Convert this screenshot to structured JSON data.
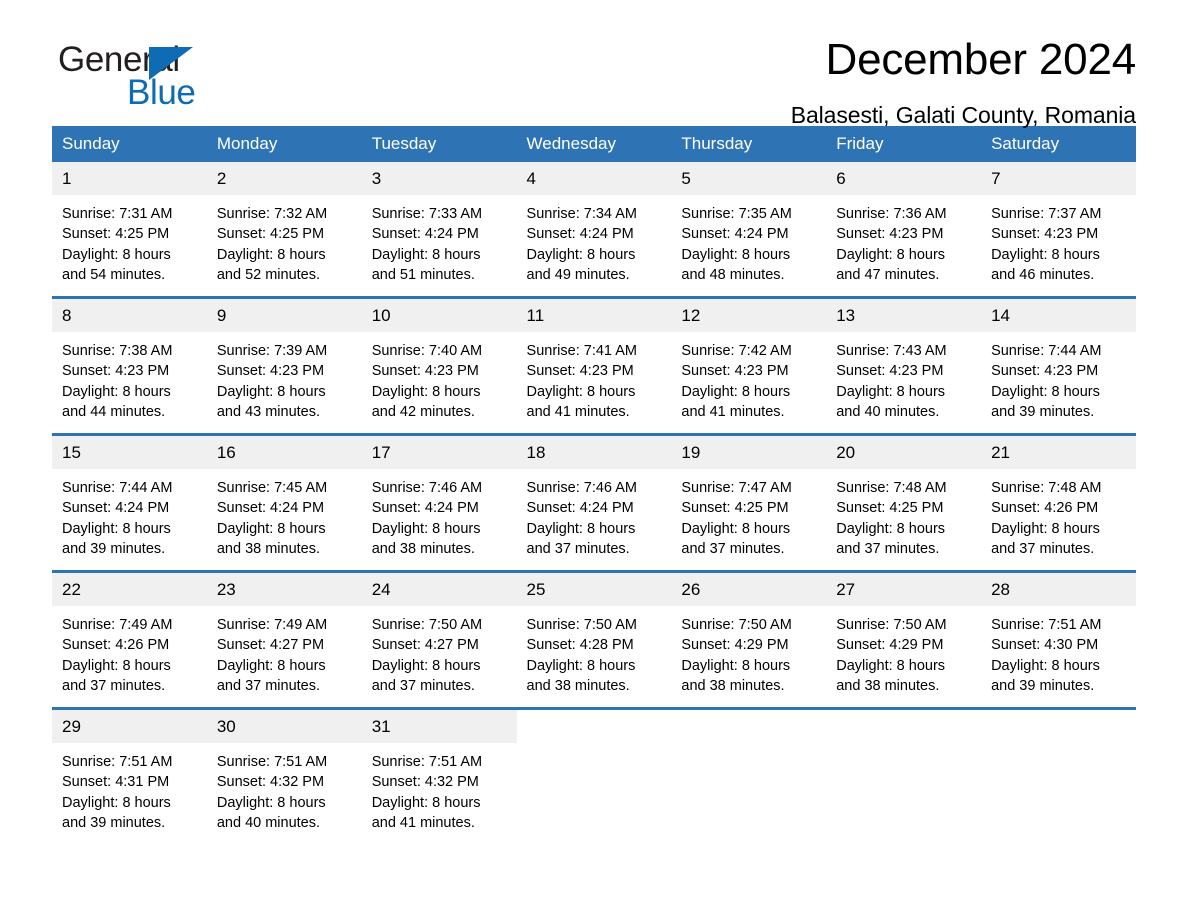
{
  "brand": {
    "name_top": "General",
    "name_bottom": "Blue",
    "triangle_icon": "triangle-icon",
    "color_blue": "#0e6cb5",
    "color_black": "#231f20"
  },
  "header": {
    "title": "December 2024",
    "subtitle": "Balasesti, Galati County, Romania"
  },
  "theme": {
    "header_blue": "#2e74b5",
    "daynum_band": "#f0f0f0",
    "text": "#000000"
  },
  "calendar": {
    "weekday_headers": [
      "Sunday",
      "Monday",
      "Tuesday",
      "Wednesday",
      "Thursday",
      "Friday",
      "Saturday"
    ],
    "weeks": [
      [
        {
          "day": "1",
          "info": "Sunrise: 7:31 AM\nSunset: 4:25 PM\nDaylight: 8 hours\nand 54 minutes."
        },
        {
          "day": "2",
          "info": "Sunrise: 7:32 AM\nSunset: 4:25 PM\nDaylight: 8 hours\nand 52 minutes."
        },
        {
          "day": "3",
          "info": "Sunrise: 7:33 AM\nSunset: 4:24 PM\nDaylight: 8 hours\nand 51 minutes."
        },
        {
          "day": "4",
          "info": "Sunrise: 7:34 AM\nSunset: 4:24 PM\nDaylight: 8 hours\nand 49 minutes."
        },
        {
          "day": "5",
          "info": "Sunrise: 7:35 AM\nSunset: 4:24 PM\nDaylight: 8 hours\nand 48 minutes."
        },
        {
          "day": "6",
          "info": "Sunrise: 7:36 AM\nSunset: 4:23 PM\nDaylight: 8 hours\nand 47 minutes."
        },
        {
          "day": "7",
          "info": "Sunrise: 7:37 AM\nSunset: 4:23 PM\nDaylight: 8 hours\nand 46 minutes."
        }
      ],
      [
        {
          "day": "8",
          "info": "Sunrise: 7:38 AM\nSunset: 4:23 PM\nDaylight: 8 hours\nand 44 minutes."
        },
        {
          "day": "9",
          "info": "Sunrise: 7:39 AM\nSunset: 4:23 PM\nDaylight: 8 hours\nand 43 minutes."
        },
        {
          "day": "10",
          "info": "Sunrise: 7:40 AM\nSunset: 4:23 PM\nDaylight: 8 hours\nand 42 minutes."
        },
        {
          "day": "11",
          "info": "Sunrise: 7:41 AM\nSunset: 4:23 PM\nDaylight: 8 hours\nand 41 minutes."
        },
        {
          "day": "12",
          "info": "Sunrise: 7:42 AM\nSunset: 4:23 PM\nDaylight: 8 hours\nand 41 minutes."
        },
        {
          "day": "13",
          "info": "Sunrise: 7:43 AM\nSunset: 4:23 PM\nDaylight: 8 hours\nand 40 minutes."
        },
        {
          "day": "14",
          "info": "Sunrise: 7:44 AM\nSunset: 4:23 PM\nDaylight: 8 hours\nand 39 minutes."
        }
      ],
      [
        {
          "day": "15",
          "info": "Sunrise: 7:44 AM\nSunset: 4:24 PM\nDaylight: 8 hours\nand 39 minutes."
        },
        {
          "day": "16",
          "info": "Sunrise: 7:45 AM\nSunset: 4:24 PM\nDaylight: 8 hours\nand 38 minutes."
        },
        {
          "day": "17",
          "info": "Sunrise: 7:46 AM\nSunset: 4:24 PM\nDaylight: 8 hours\nand 38 minutes."
        },
        {
          "day": "18",
          "info": "Sunrise: 7:46 AM\nSunset: 4:24 PM\nDaylight: 8 hours\nand 37 minutes."
        },
        {
          "day": "19",
          "info": "Sunrise: 7:47 AM\nSunset: 4:25 PM\nDaylight: 8 hours\nand 37 minutes."
        },
        {
          "day": "20",
          "info": "Sunrise: 7:48 AM\nSunset: 4:25 PM\nDaylight: 8 hours\nand 37 minutes."
        },
        {
          "day": "21",
          "info": "Sunrise: 7:48 AM\nSunset: 4:26 PM\nDaylight: 8 hours\nand 37 minutes."
        }
      ],
      [
        {
          "day": "22",
          "info": "Sunrise: 7:49 AM\nSunset: 4:26 PM\nDaylight: 8 hours\nand 37 minutes."
        },
        {
          "day": "23",
          "info": "Sunrise: 7:49 AM\nSunset: 4:27 PM\nDaylight: 8 hours\nand 37 minutes."
        },
        {
          "day": "24",
          "info": "Sunrise: 7:50 AM\nSunset: 4:27 PM\nDaylight: 8 hours\nand 37 minutes."
        },
        {
          "day": "25",
          "info": "Sunrise: 7:50 AM\nSunset: 4:28 PM\nDaylight: 8 hours\nand 38 minutes."
        },
        {
          "day": "26",
          "info": "Sunrise: 7:50 AM\nSunset: 4:29 PM\nDaylight: 8 hours\nand 38 minutes."
        },
        {
          "day": "27",
          "info": "Sunrise: 7:50 AM\nSunset: 4:29 PM\nDaylight: 8 hours\nand 38 minutes."
        },
        {
          "day": "28",
          "info": "Sunrise: 7:51 AM\nSunset: 4:30 PM\nDaylight: 8 hours\nand 39 minutes."
        }
      ],
      [
        {
          "day": "29",
          "info": "Sunrise: 7:51 AM\nSunset: 4:31 PM\nDaylight: 8 hours\nand 39 minutes."
        },
        {
          "day": "30",
          "info": "Sunrise: 7:51 AM\nSunset: 4:32 PM\nDaylight: 8 hours\nand 40 minutes."
        },
        {
          "day": "31",
          "info": "Sunrise: 7:51 AM\nSunset: 4:32 PM\nDaylight: 8 hours\nand 41 minutes."
        },
        {
          "day": "",
          "info": ""
        },
        {
          "day": "",
          "info": ""
        },
        {
          "day": "",
          "info": ""
        },
        {
          "day": "",
          "info": ""
        }
      ]
    ]
  }
}
